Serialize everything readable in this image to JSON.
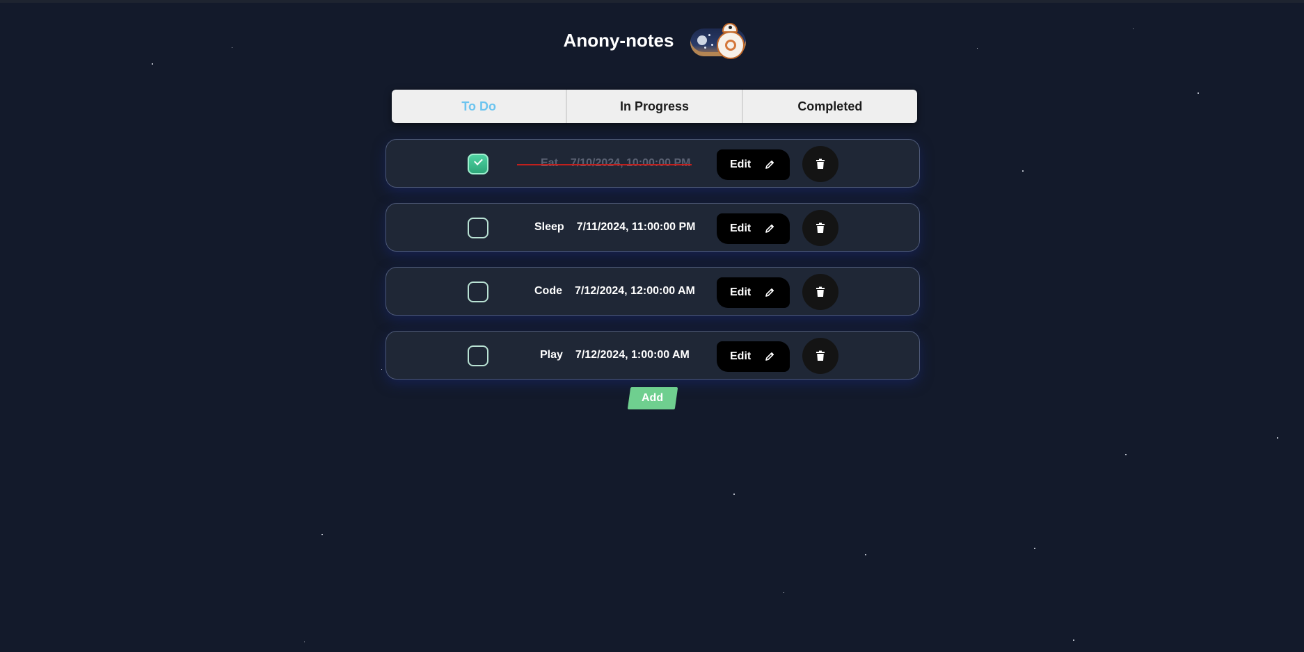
{
  "app": {
    "title": "Anony-notes",
    "theme_toggle_icon": "dark-mode-toggle-bb8-icon"
  },
  "tabs": [
    {
      "label": "To Do",
      "active": true
    },
    {
      "label": "In Progress",
      "active": false
    },
    {
      "label": "Completed",
      "active": false
    }
  ],
  "tasks": [
    {
      "name": "Eat",
      "datetime": "7/10/2024, 10:00:00 PM",
      "checked": true
    },
    {
      "name": "Sleep",
      "datetime": "7/11/2024, 11:00:00 PM",
      "checked": false
    },
    {
      "name": "Code",
      "datetime": "7/12/2024, 12:00:00 AM",
      "checked": false
    },
    {
      "name": "Play",
      "datetime": "7/12/2024, 1:00:00 AM",
      "checked": false
    }
  ],
  "actions": {
    "edit_label": "Edit",
    "edit_icon": "pencil-icon",
    "delete_icon": "trash-icon",
    "add_label": "Add"
  },
  "colors": {
    "background": "#131a2b",
    "active_tab": "#6cc4ef",
    "add_button": "#6fcf8f",
    "checkbox_checked": "#3cc08f",
    "strike": "#c0201d"
  }
}
